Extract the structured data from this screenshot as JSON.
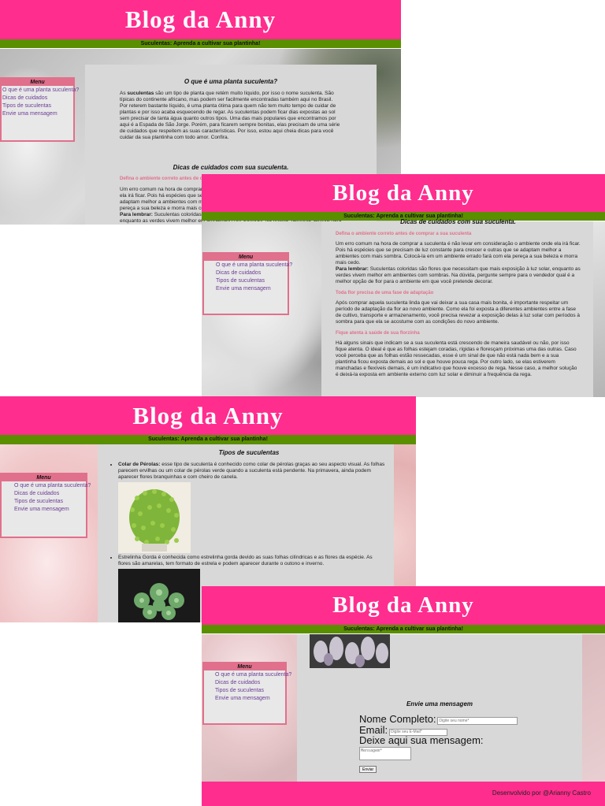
{
  "site": {
    "title": "Blog da Anny",
    "tagline": "Suculentas: Aprenda a cultivar sua plantinha!"
  },
  "menu": {
    "title": "Menu",
    "items": [
      "O que é uma planta suculenta?",
      "Dicas de cuidados",
      "Tipos de suculentas",
      "Envie uma mensagem"
    ]
  },
  "section1": {
    "heading": "O que é uma planta suculenta?",
    "intro_prefix": "As ",
    "intro_bold": "suculentas",
    "intro_rest": " são um tipo de planta que retém muito líquido, por isso o nome suculenta. São típicas do continente africano, mas podem ser facilmente encontradas também aqui no Brasil. Por reterem bastante líquido, é uma planta ótima para quem não tem muito tempo de cuidar de plantas e por isso acaba esquecendo de regar. As suculentas podem ficar dias expostas ao sol sem precisar de tanta água quanto outros tipos. Uma das mais populares que encontramos por aqui é a Espada de São Jorge. Porém, para ficarem sempre bonitas, elas precisam de uma série de cuidados que respeitem as suas características. Por isso, estou aqui cheia dicas para você cuidar da sua plantinha com todo amor. Confira."
  },
  "section2": {
    "heading": "Dicas de cuidados com sua suculenta.",
    "tip1_title": "Defina o ambiente correto antes de comprar a sua suculenta",
    "tip1_text": "Um erro comum na hora de comprar a suculenta é não levar em consideração o ambiente onde ela irá ficar. Pois há espécies que se precisam de luz constante para crescer e outras que se adaptam melhor a ambientes com mais sombra. Colocá-la em um ambiente errado fará com ela pereça a sua beleza e morra mais cedo.",
    "tip1_note_bold": "Para lembrar:",
    "tip1_note": " Suculentas coloridas são flores que necessitam que mais exposição à luz solar, enquanto as verdes vivem melhor em ambientes com sombras. Na dúvida, pergunte sempre para o vendedor qual é a melhor opção de flor para o ambiente em que você pretende decorar.",
    "tip2_title": "Toda flor precisa de uma fase de adaptação",
    "tip2_text": "Após comprar aquela suculenta linda que vai deixar a sua casa mais bonita, é importante respeitar um período de adaptação da flor ao novo ambiente. Como ela foi exposta a diferentes ambientes entre a fase de cultivo, transporte e armazenamento, você precisa revezar a exposição delas à luz solar com períodos à sombra para que ela se acostume com as condições do novo ambiente.",
    "tip3_title": "Fique atenta à saúde de sua florzinha",
    "tip3_text": "Há alguns sinais que indicam se a sua suculenta está crescendo de maneira saudável ou não, por isso fique atenta. O ideal é que as folhas estejam coradas, rígidas e floresçam próximas uma das outras. Caso você perceba que as folhas estão ressecadas, esse é um sinal de que não está nada bem e a sua plantinha ficou exposta demais ao sol e que houve pouca rega. Por outro lado, se elas estiverem manchadas e flexíveis demais, é um indicativo que houve excesso de rega. Nesse caso, a melhor solução é deixá-la exposta em ambiente externo com luz solar e diminuir a frequência da rega."
  },
  "section3": {
    "heading": "Tipos de suculentas",
    "type1_bold": "Colar de Pérolas:",
    "type1_text": " esse tipo de suculenta é conhecido como colar de pérolas graças ao seu aspecto visual. As folhas parecem ervilhas ou um colar de pérolas verde quando a suculenta está pendente. Na primavera, ainda podem aparecer flores branquinhas e com cheiro de canela.",
    "type2_text": "Estrelinha Gorda é conhecida como estrelinha gorda devido as suas folhas cilíndricas e as flores da espécie. As flores são amarelas, tem formato de estrela e podem aparecer durante o outono e inverno."
  },
  "contact": {
    "heading": "Envie uma mensagem",
    "name_label": "Nome Completo:",
    "name_placeholder": "Digite seu nome*",
    "email_label": "Email:",
    "email_placeholder": "Digite seu E-Mail*",
    "message_label": "Deixe aqui sua mensagem:",
    "message_placeholder": "Mensagem*",
    "submit_label": "Enviar"
  },
  "footer": {
    "text": "Desenvolvido por @Arianny Castro"
  }
}
